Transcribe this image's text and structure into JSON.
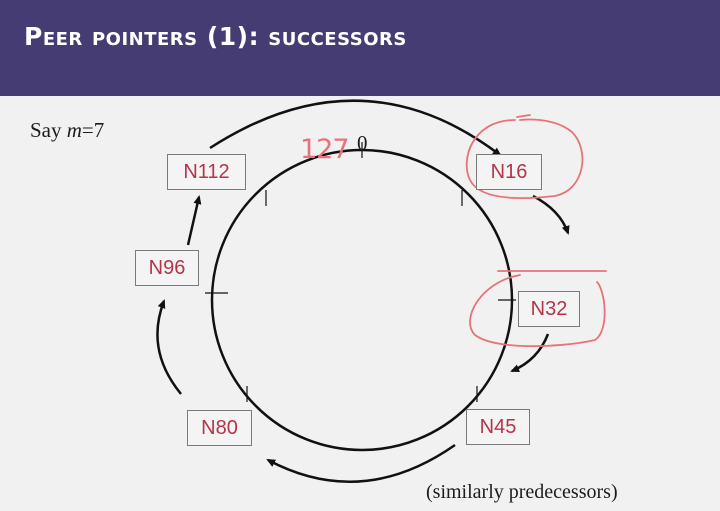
{
  "slide": {
    "title": "Peer pointers (1): successors",
    "say_prefix": "Say ",
    "say_var": "m",
    "say_suffix": "=7",
    "zero_label": "0",
    "annotation": "127",
    "footnote": "(similarly predecessors)"
  },
  "nodes": {
    "n112": "N112",
    "n16": "N16",
    "n32": "N32",
    "n45": "N45",
    "n80": "N80",
    "n96": "N96"
  },
  "colors": {
    "title_bg": "#443c72",
    "node_text": "#b5344a",
    "annotation_ink": "#e8727a"
  }
}
